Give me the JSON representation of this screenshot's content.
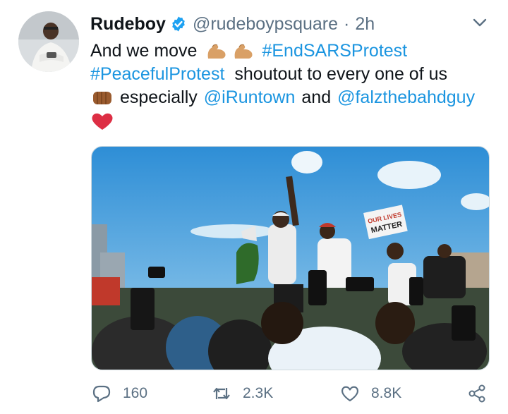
{
  "tweet": {
    "display_name": "Rudeboy",
    "handle": "@rudeboypsquare",
    "separator": "·",
    "time": "2h",
    "text": {
      "line1_prefix": "And we move",
      "hashtag1": "#EndSARSProtest",
      "hashtag2": "#PeacefulProtest",
      "line2_suffix": "shoutout to every one of us",
      "line3_word": "especially",
      "mention1": "@iRuntown",
      "and_word": "and",
      "mention2": "@falzthebahdguy"
    },
    "emojis": [
      "flexed-biceps-emoji",
      "flexed-biceps-emoji",
      "oncoming-fist-emoji",
      "red-heart-emoji"
    ],
    "photo": {
      "sign_text_line1": "OUR LIVES",
      "sign_text_line2": "MATTER"
    }
  },
  "actions": {
    "reply_count": "160",
    "retweet_count": "2.3K",
    "like_count": "8.8K"
  },
  "colors": {
    "accent": "#1b95e0",
    "verified": "#1da1f2",
    "muted": "#5b7083",
    "heart": "#e0245e"
  }
}
